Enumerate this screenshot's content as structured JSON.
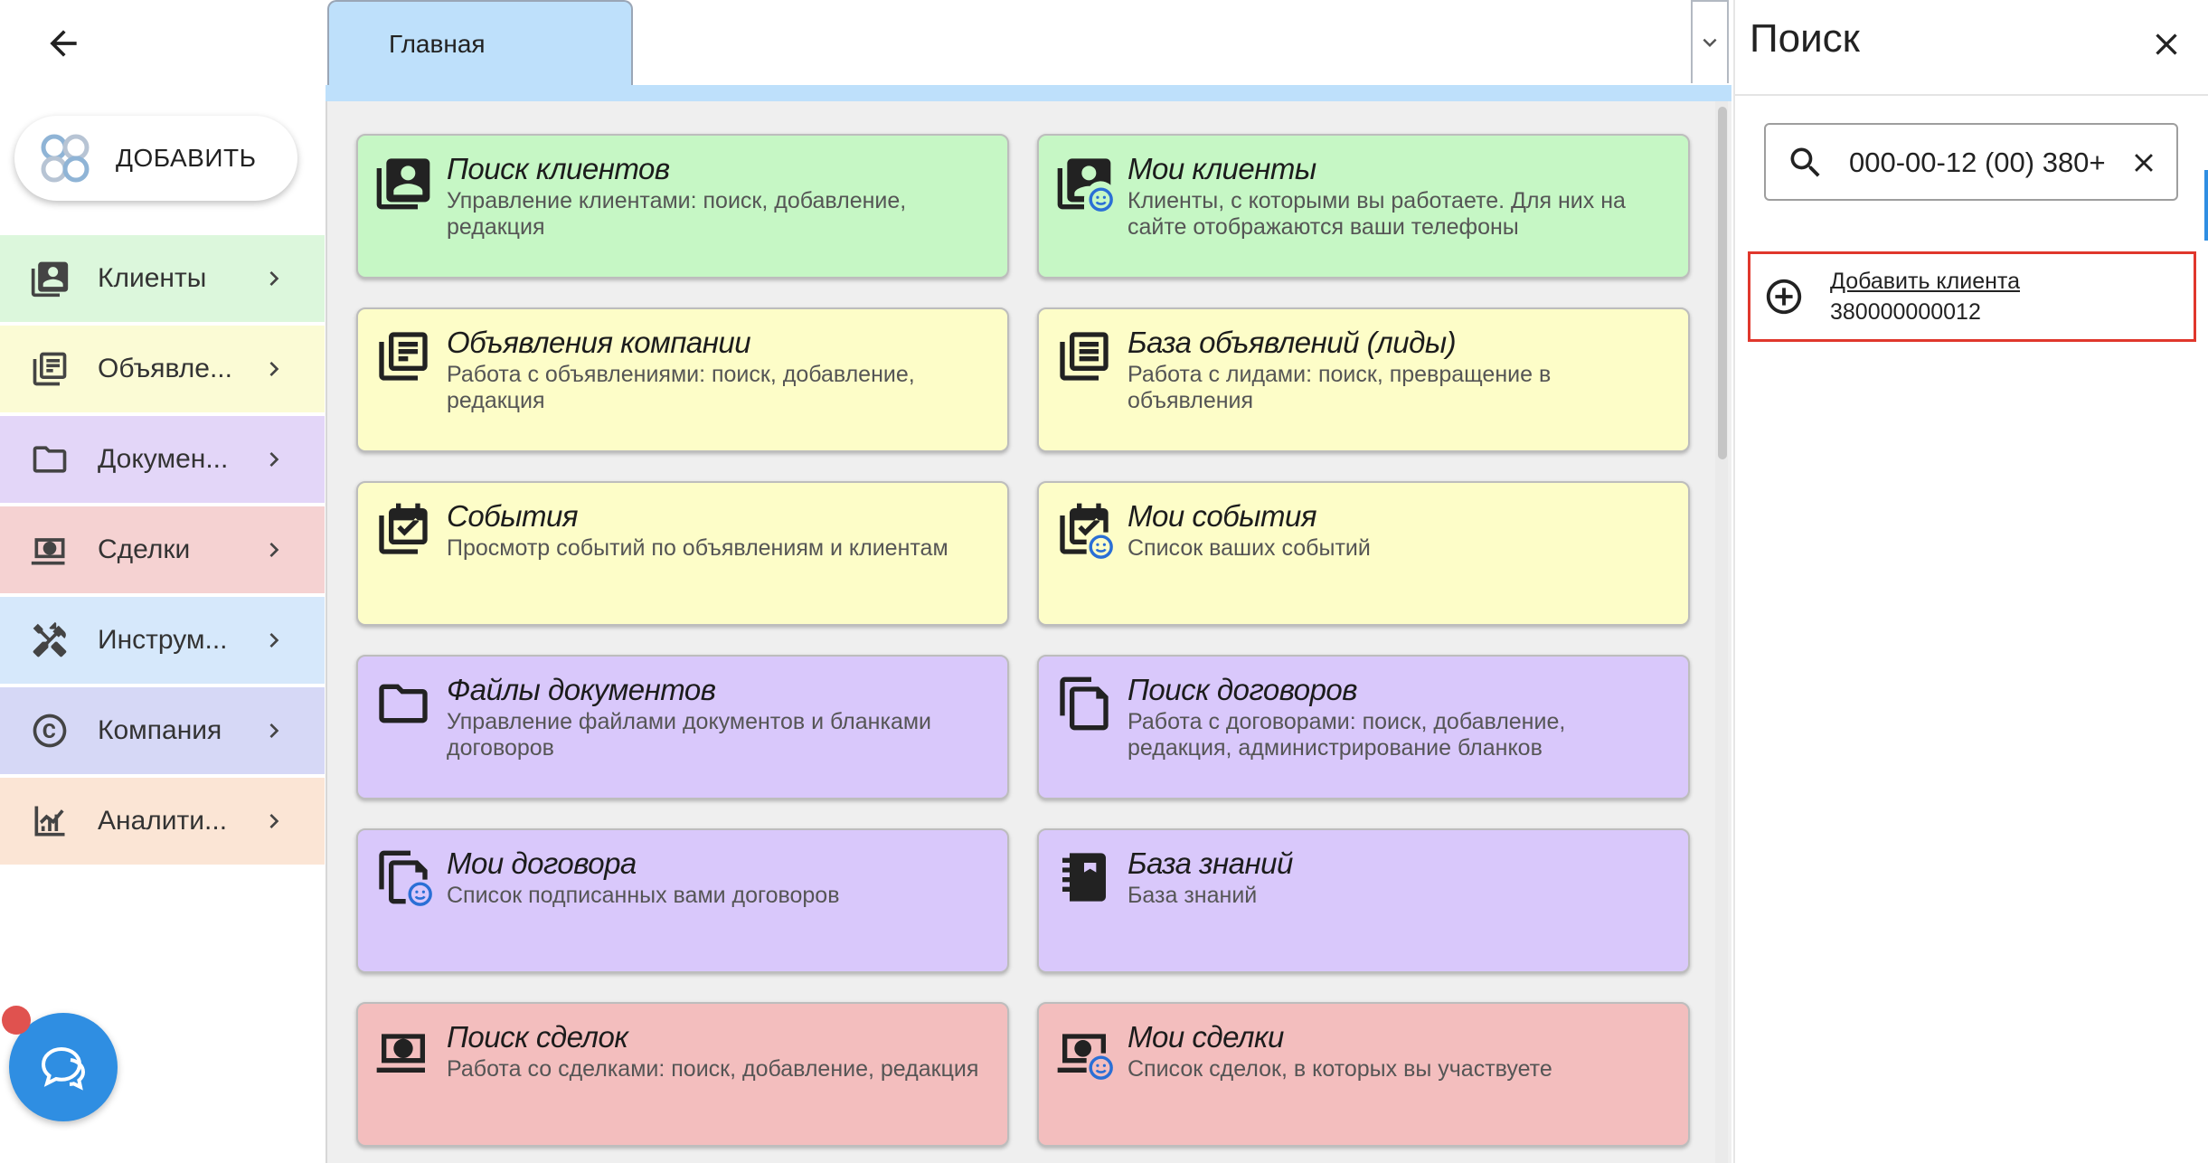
{
  "sidebar": {
    "add_button_label": "ДОБАВИТЬ",
    "items": [
      {
        "label": "Клиенты",
        "color": "#dcf7dc"
      },
      {
        "label": "Объявле...",
        "color": "#fbfbd5"
      },
      {
        "label": "Докумен...",
        "color": "#e3d6f8"
      },
      {
        "label": "Сделки",
        "color": "#f5d2d2"
      },
      {
        "label": "Инструм...",
        "color": "#d6e8fb"
      },
      {
        "label": "Компания",
        "color": "#d6d8f6"
      },
      {
        "label": "Аналити...",
        "color": "#fbe5d5"
      }
    ]
  },
  "tabs": {
    "active": "Главная"
  },
  "cards": [
    {
      "title": "Поиск клиентов",
      "desc": "Управление клиентами: поиск, добавление, редакция",
      "icon": "client-card-icon"
    },
    {
      "title": "Мои клиенты",
      "desc": "Клиенты, с которыми вы работаете. Для них на сайте отображаются ваши телефоны",
      "icon": "client-card-smile-icon"
    },
    {
      "title": "Объявления компании",
      "desc": "Работа с объявлениями: поиск, добавление, редакция",
      "icon": "listings-icon"
    },
    {
      "title": "База объявлений (лиды)",
      "desc": "Работа с лидами: поиск, превращение в объявления",
      "icon": "article-stack-icon"
    },
    {
      "title": "События",
      "desc": "Просмотр событий по объявлениям и клиентам",
      "icon": "calendar-check-icon"
    },
    {
      "title": "Мои события",
      "desc": "Список ваших событий",
      "icon": "calendar-check-smile-icon"
    },
    {
      "title": "Файлы документов",
      "desc": "Управление файлами документов и бланками договоров",
      "icon": "folder-icon"
    },
    {
      "title": "Поиск договоров",
      "desc": "Работа с договорами: поиск, добавление, редакция, администрирование бланков",
      "icon": "documents-icon"
    },
    {
      "title": "Мои договора",
      "desc": "Список подписанных вами договоров",
      "icon": "documents-smile-icon"
    },
    {
      "title": "База знаний",
      "desc": "База знаний",
      "icon": "notebook-icon"
    },
    {
      "title": "Поиск сделок",
      "desc": "Работа со сделками: поиск, добавление, редакция",
      "icon": "money-icon"
    },
    {
      "title": "Мои сделки",
      "desc": "Список сделок, в которых вы участвуете",
      "icon": "money-smile-icon"
    }
  ],
  "search": {
    "title": "Поиск",
    "query": "+380 (00) 000-00-12",
    "result": {
      "title": "Добавить клиента",
      "subtitle": "380000000012"
    }
  },
  "colors": {
    "tab_active": "#bee0fb",
    "card_green": "#c6f7c5",
    "card_yellow": "#fdfdc8",
    "card_purple": "#d9c8fb",
    "card_red": "#f3bebe",
    "highlight_border": "#e0372c",
    "chat_button": "#2f8ee2"
  }
}
